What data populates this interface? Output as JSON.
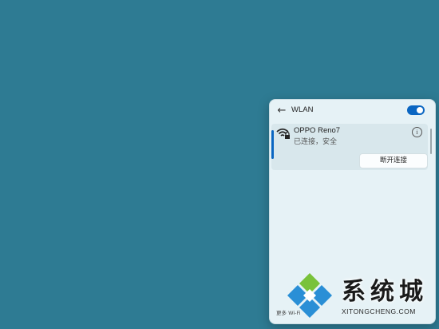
{
  "wifi_panel": {
    "title": "WLAN",
    "toggle_on": true,
    "network": {
      "name": "OPPO Reno7",
      "status": "已连接，安全",
      "disconnect_label": "断开连接"
    },
    "more_settings_label": "更多 Wi-Fi"
  },
  "watermark": {
    "text_cn": "系统城",
    "text_en": "XITONGCHENG.COM"
  },
  "colors": {
    "desktop": "#2e7b93",
    "panel": "#e6f2f6",
    "accent": "#0a66c2"
  },
  "icons": [
    "back-arrow-icon",
    "wifi-lock-icon",
    "info-icon"
  ]
}
